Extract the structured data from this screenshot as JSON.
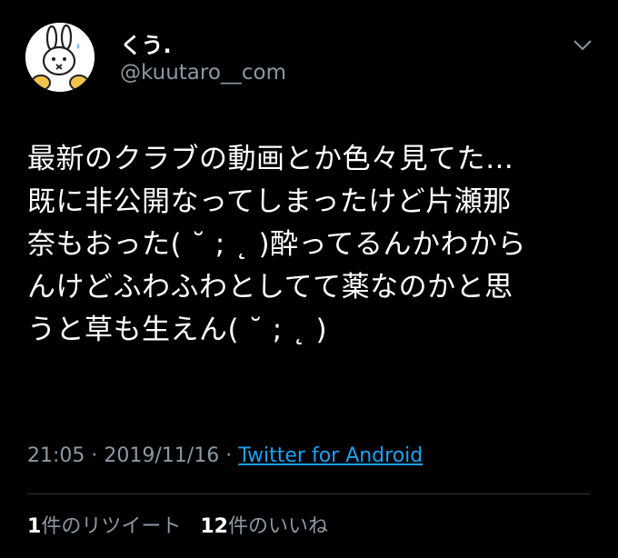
{
  "author": {
    "display_name": "くう.",
    "handle": "@kuutaro__com",
    "avatar_icon": "rabbit-character-icon",
    "menu_icon": "chevron-down-icon"
  },
  "tweet": {
    "lines": [
      "最新のクラブの動画とか色々見てた…",
      "既に非公開なってしまったけど片瀬那",
      "奈もおった( ˘ ; ˛ )酔ってるんかわから",
      "んけどふわふわとしてて薬なのかと思",
      "うと草も生えん( ˘ ; ˛ )"
    ]
  },
  "meta": {
    "time": "21:05",
    "separator": "·",
    "date": "2019/11/16",
    "source": "Twitter for Android"
  },
  "stats": {
    "retweet_count": "1",
    "retweet_label": "件のリツイート",
    "like_count": "12",
    "like_label": "件のいいね"
  },
  "colors": {
    "background": "#000000",
    "text": "#ffffff",
    "secondary": "#8b98a5",
    "link": "#1da1f2",
    "divider": "#2f3336"
  }
}
